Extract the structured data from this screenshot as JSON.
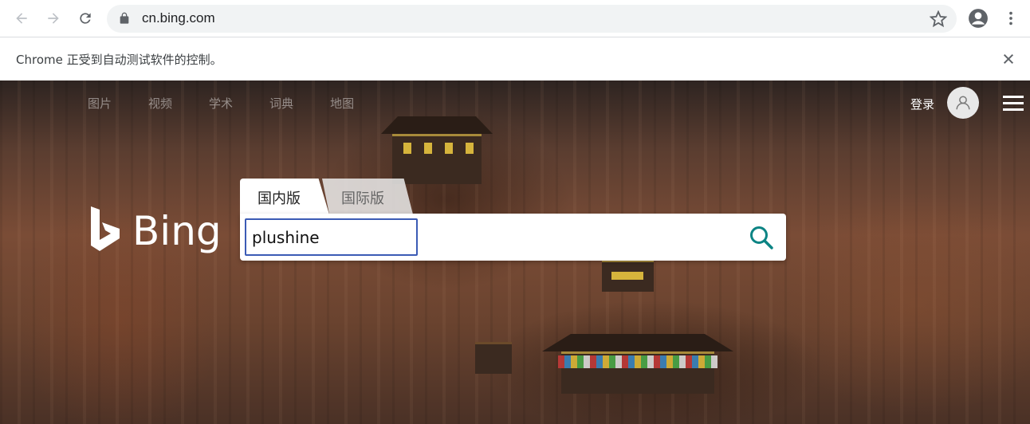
{
  "browser": {
    "url": "cn.bing.com",
    "infobar_text": "Chrome 正受到自动测试软件的控制。",
    "icons": [
      "back-icon",
      "forward-icon",
      "reload-icon",
      "lock-icon",
      "star-icon",
      "account-icon",
      "menu-dots-icon",
      "close-icon"
    ]
  },
  "bing": {
    "nav": [
      "图片",
      "视频",
      "学术",
      "词典",
      "地图"
    ],
    "login_label": "登录",
    "logo_text": "Bing",
    "tabs": {
      "domestic": "国内版",
      "international": "国际版"
    },
    "search_value": "plushine",
    "colors": {
      "accent": "#3b5bb5",
      "search_icon": "#0c8484"
    }
  }
}
